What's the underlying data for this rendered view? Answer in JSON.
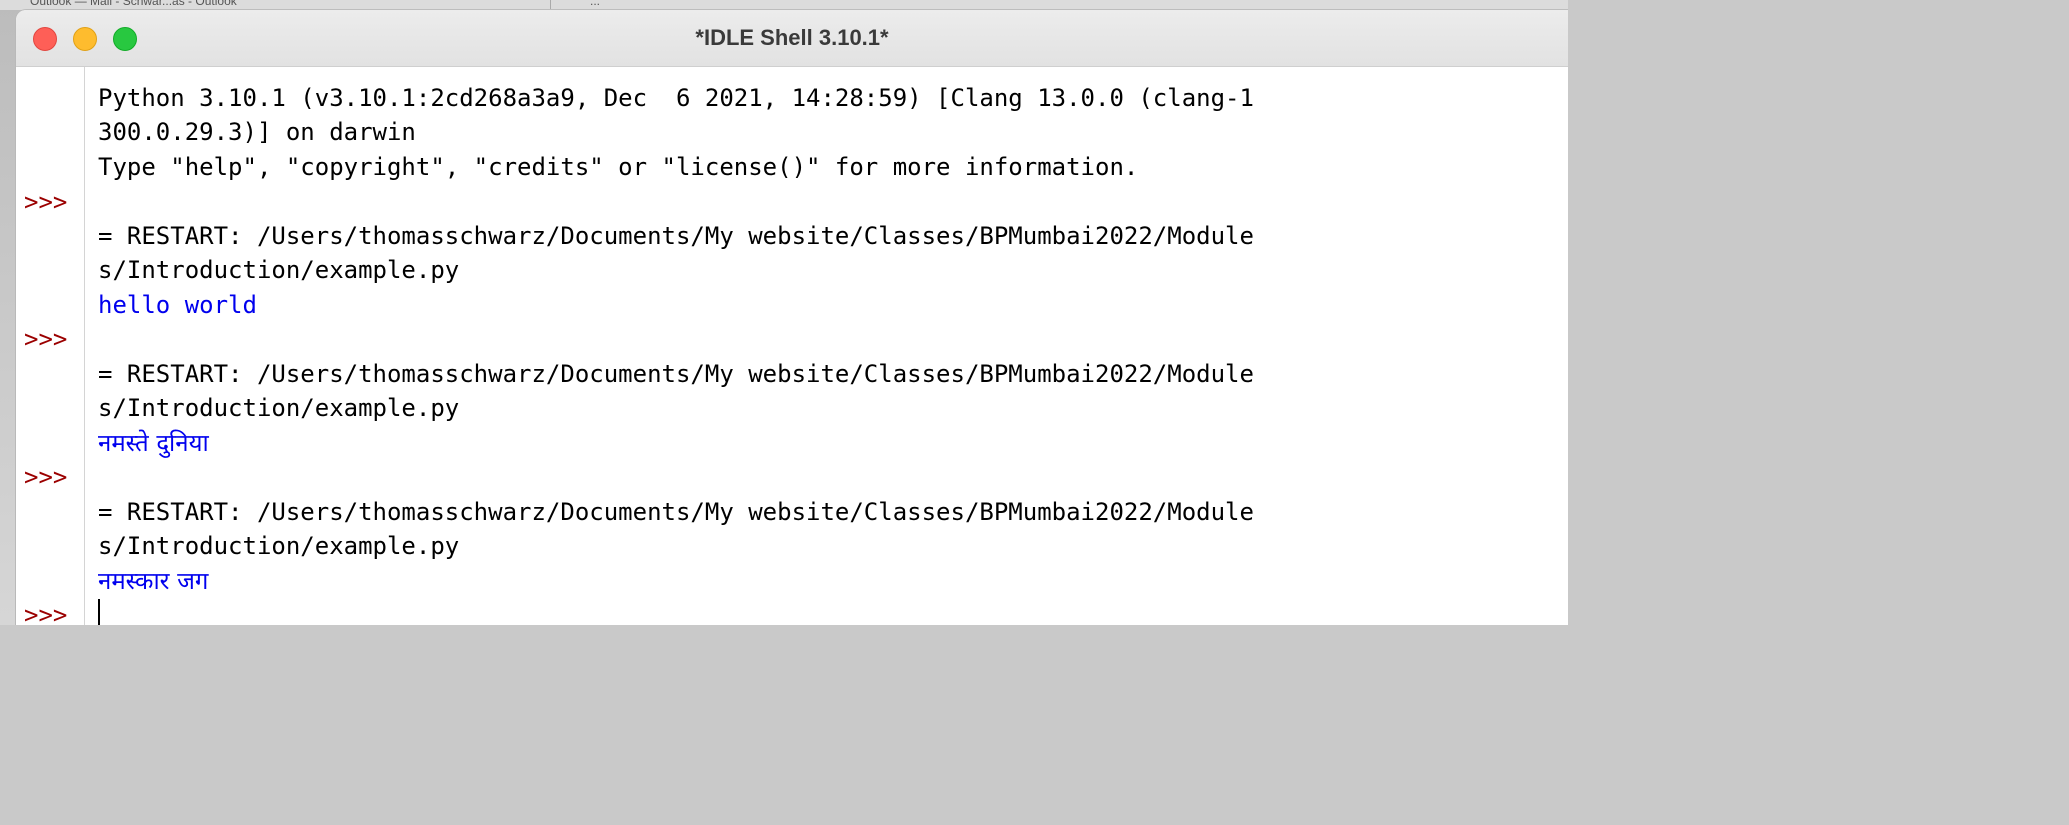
{
  "window": {
    "title": "*IDLE Shell 3.10.1*"
  },
  "background_tabs": [
    "Outlook — Mail - Schwar...as - Outlook",
    "..."
  ],
  "colors": {
    "prompt": "#9b0000",
    "output": "#0000ee",
    "text": "#000000",
    "close": "#fe5f57",
    "minimize": "#febc2e",
    "zoom": "#28c840"
  },
  "shell": {
    "prompt": ">>>",
    "lines": [
      "Python 3.10.1 (v3.10.1:2cd268a3a9, Dec  6 2021, 14:28:59) [Clang 13.0.0 (clang-1",
      "300.0.29.3)] on darwin",
      "Type \"help\", \"copyright\", \"credits\" or \"license()\" for more information.",
      "= RESTART: /Users/thomasschwarz/Documents/My website/Classes/BPMumbai2022/Module",
      "s/Introduction/example.py",
      "hello world",
      "= RESTART: /Users/thomasschwarz/Documents/My website/Classes/BPMumbai2022/Module",
      "s/Introduction/example.py",
      "नमस्ते दुनिया",
      "= RESTART: /Users/thomasschwarz/Documents/My website/Classes/BPMumbai2022/Module",
      "s/Introduction/example.py",
      "नमस्कार जग"
    ]
  }
}
